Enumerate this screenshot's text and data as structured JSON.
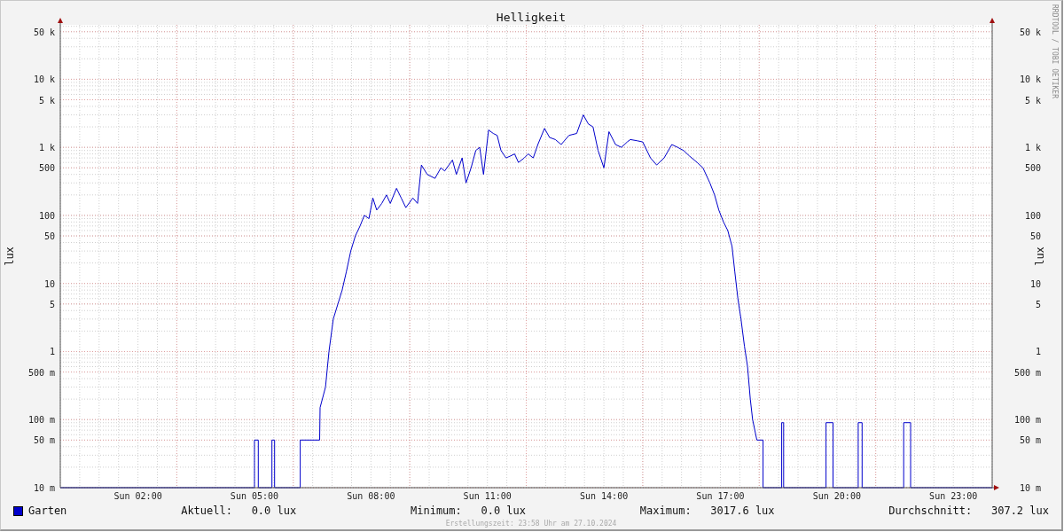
{
  "title": "Helligkeit",
  "watermark": "RRDTOOL / TOBI OETIKER",
  "left_axis": {
    "label": "lux",
    "tick_labels": [
      "50 k",
      "10 k",
      "5 k",
      "1 k",
      "500",
      "100",
      "50",
      "10",
      "5",
      "1",
      "500 m",
      "100 m",
      "50 m",
      "10 m"
    ]
  },
  "right_axis": {
    "label": "lux",
    "tick_labels": [
      "50 k",
      "10 k",
      "5 k",
      "1 k",
      "500",
      "100",
      "50",
      "10",
      "5",
      "1",
      "500 m",
      "100 m",
      "50 m",
      "10 m"
    ]
  },
  "x_axis": {
    "tick_labels": [
      "Sun 02:00",
      "Sun 05:00",
      "Sun 08:00",
      "Sun 11:00",
      "Sun 14:00",
      "Sun 17:00",
      "Sun 20:00",
      "Sun 23:00"
    ]
  },
  "legend": {
    "name": "Garten",
    "color": "#0000cc"
  },
  "stats": [
    {
      "label": "Aktuell:",
      "value": "0.0 lux"
    },
    {
      "label": "Minimum:",
      "value": "0.0 lux"
    },
    {
      "label": "Maximum:",
      "value": "3017.6 lux"
    },
    {
      "label": "Durchschnitt:",
      "value": "307.2 lux"
    }
  ],
  "footer": "Erstellungszeit: 23:58 Uhr am 27.10.2024"
}
